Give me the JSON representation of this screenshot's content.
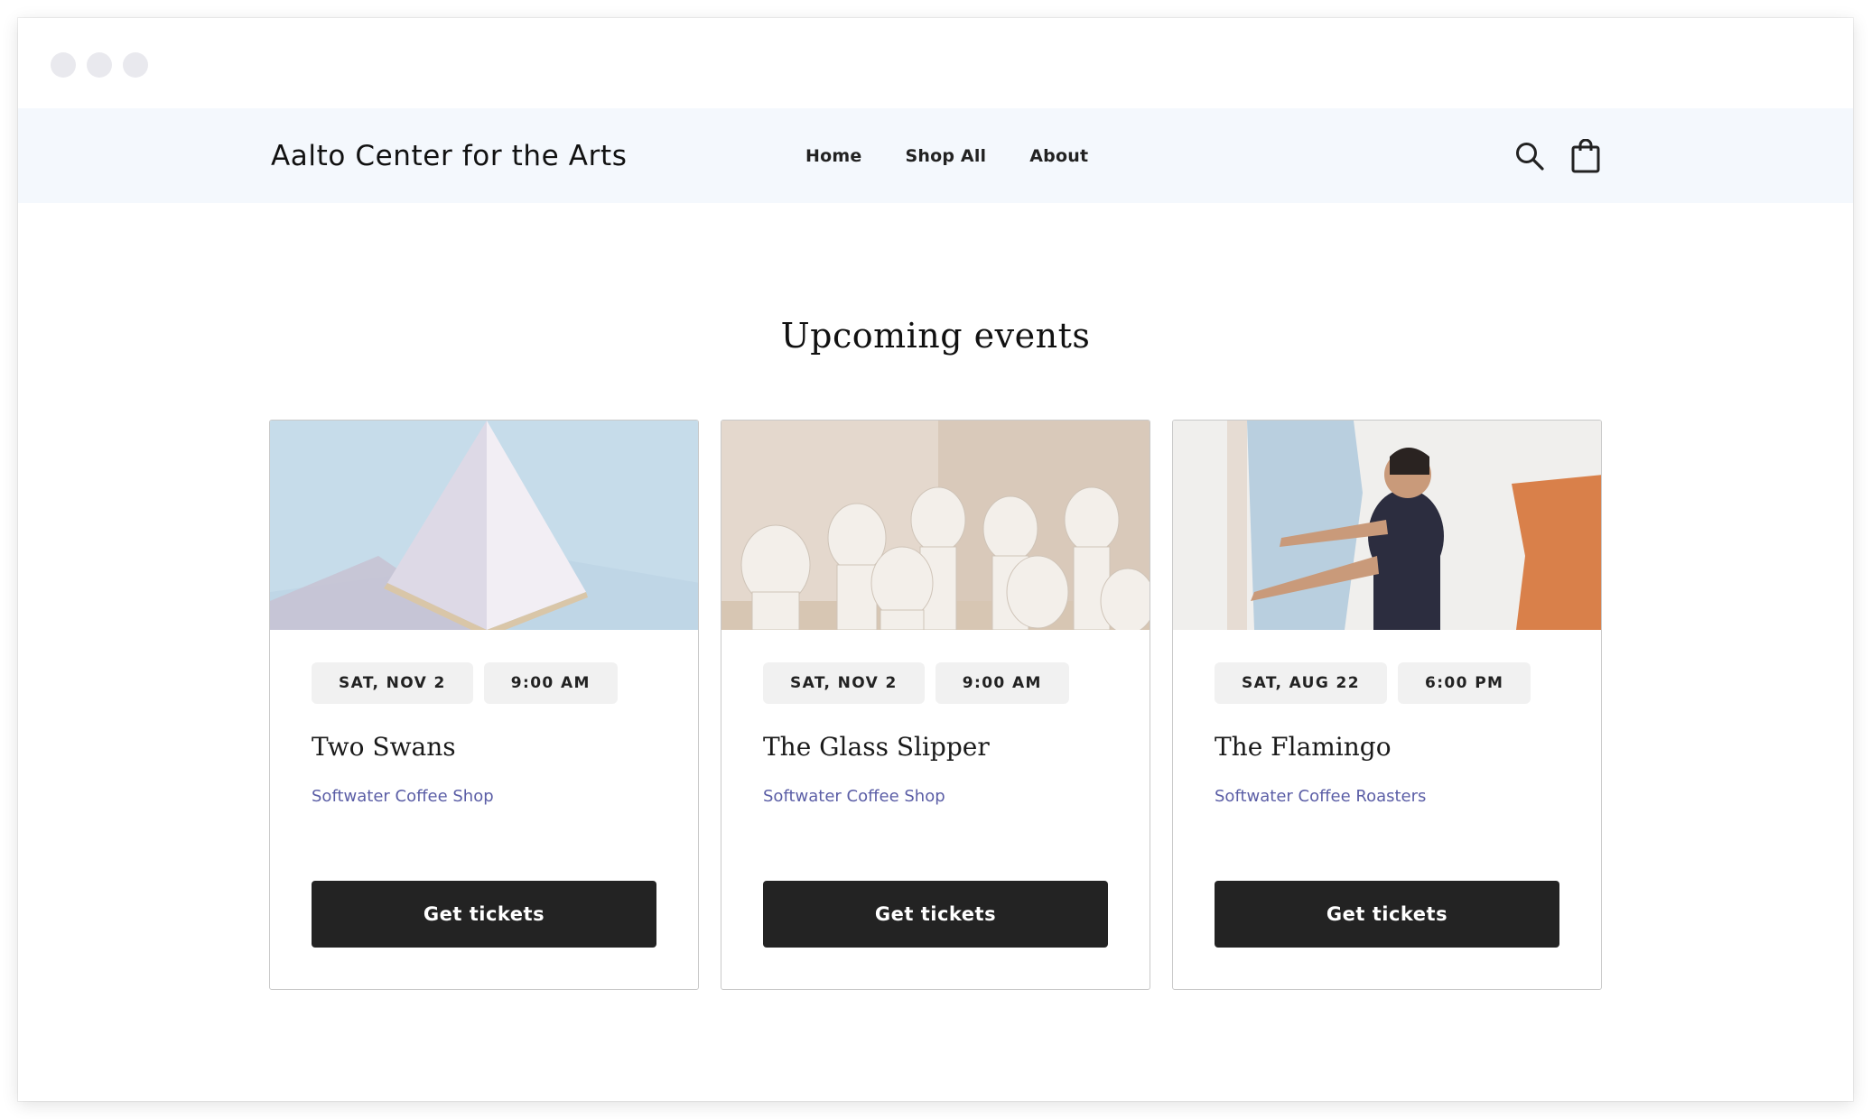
{
  "header": {
    "brand": "Aalto Center for the Arts",
    "nav": [
      {
        "label": "Home"
      },
      {
        "label": "Shop All"
      },
      {
        "label": "About"
      }
    ],
    "icons": [
      "search-icon",
      "shopping-bag-icon"
    ]
  },
  "main": {
    "title": "Upcoming events",
    "events": [
      {
        "date": "SAT, NOV 2",
        "time": "9:00 AM",
        "name": "Two Swans",
        "venue": "Softwater Coffee Shop",
        "button": "Get tickets"
      },
      {
        "date": "SAT, NOV 2",
        "time": "9:00 AM",
        "name": "The Glass Slipper",
        "venue": "Softwater Coffee Shop",
        "button": "Get tickets"
      },
      {
        "date": "SAT, AUG 22",
        "time": "6:00 PM",
        "name": "The Flamingo",
        "venue": "Softwater Coffee Roasters",
        "button": "Get tickets"
      }
    ]
  },
  "colors": {
    "header_bg": "#f4f8fd",
    "venue_link": "#5b5ea6",
    "button_bg": "#232323",
    "pill_bg": "#f1f1f1"
  }
}
